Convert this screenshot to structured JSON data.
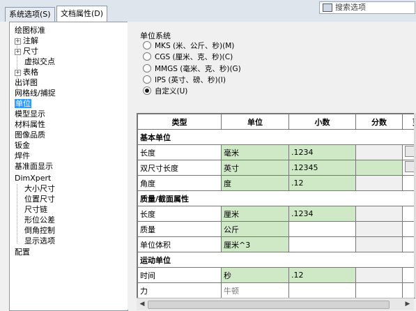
{
  "tabs": [
    {
      "label": "系统选项(S)"
    },
    {
      "label": "文档属性(D)"
    }
  ],
  "search": {
    "placeholder": "搜索选项"
  },
  "tree": [
    {
      "label": "绘图标准"
    },
    {
      "label": "注解"
    },
    {
      "label": "尺寸"
    },
    {
      "label": "虚拟交点"
    },
    {
      "label": "表格"
    },
    {
      "label": "出详图"
    },
    {
      "label": "网格线/捕捉"
    },
    {
      "label": "单位"
    },
    {
      "label": "模型显示"
    },
    {
      "label": "材料属性"
    },
    {
      "label": "图像品质"
    },
    {
      "label": "钣金"
    },
    {
      "label": "焊件"
    },
    {
      "label": "基准面显示"
    },
    {
      "label": "DimXpert"
    },
    {
      "label": "大小尺寸"
    },
    {
      "label": "位置尺寸"
    },
    {
      "label": "尺寸链"
    },
    {
      "label": "形位公差"
    },
    {
      "label": "倒角控制"
    },
    {
      "label": "显示选项"
    },
    {
      "label": "配置"
    }
  ],
  "units": {
    "group_label": "单位系统",
    "options": [
      {
        "label": "MKS (米、公斤、秒)(M)"
      },
      {
        "label": "CGS (厘米、克、秒)(C)"
      },
      {
        "label": "MMGS (毫米、克、秒)(G)"
      },
      {
        "label": "IPS (英寸、磅、秒)(I)"
      },
      {
        "label": "自定义(U)"
      }
    ],
    "selected": "自定义(U)"
  },
  "table": {
    "headers": [
      "类型",
      "单位",
      "小数",
      "分数",
      "更"
    ],
    "sections": [
      {
        "title": "基本单位",
        "rows": [
          {
            "type": "长度",
            "unit": "毫米",
            "decimal": ".1234"
          },
          {
            "type": "双尺寸长度",
            "unit": "英寸",
            "decimal": ".12345"
          },
          {
            "type": "角度",
            "unit": "度",
            "decimal": ".12"
          }
        ]
      },
      {
        "title": "质量/截面属性",
        "rows": [
          {
            "type": "长度",
            "unit": "厘米",
            "decimal": ".1234"
          },
          {
            "type": "质量",
            "unit": "公斤",
            "decimal": ""
          },
          {
            "type": "单位体积",
            "unit": "厘米^3",
            "decimal": ""
          }
        ]
      },
      {
        "title": "运动单位",
        "rows": [
          {
            "type": "时间",
            "unit": "秒",
            "decimal": ".12"
          },
          {
            "type": "力",
            "unit": "牛顿",
            "decimal": ""
          }
        ]
      }
    ]
  },
  "colors": {
    "selection": "#3399ff",
    "editable_cell": "#cfe8c6"
  }
}
